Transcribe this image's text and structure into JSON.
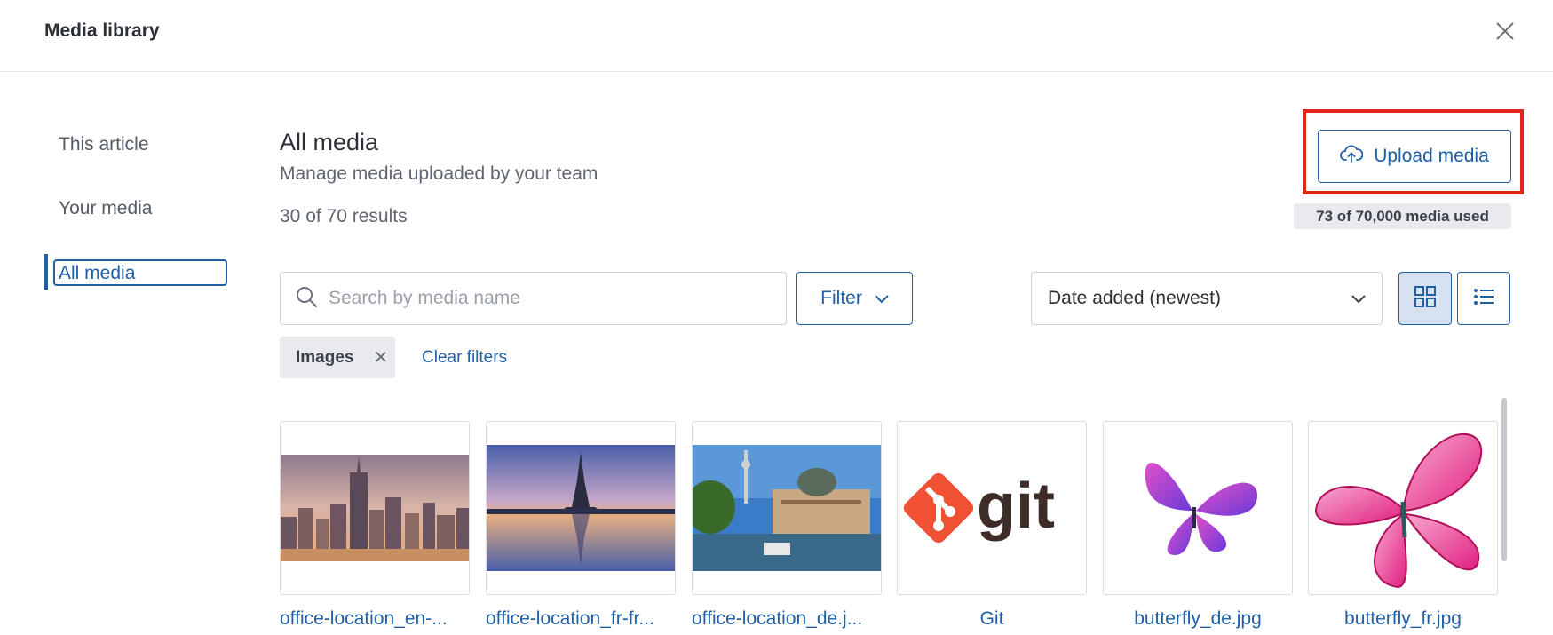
{
  "header": {
    "title": "Media library",
    "close_icon": "close-icon"
  },
  "sidebar": {
    "items": [
      {
        "label": "This article"
      },
      {
        "label": "Your media"
      },
      {
        "label": "All media",
        "active": true
      }
    ]
  },
  "main": {
    "title": "All media",
    "subtitle": "Manage media uploaded by your team",
    "results": "30 of 70 results",
    "upload_label": "Upload media",
    "upload_icon": "cloud-upload-icon",
    "usage": "73 of 70,000 media used",
    "search": {
      "placeholder": "Search by media name",
      "value": ""
    },
    "filter_label": "Filter",
    "sort_value": "Date added (newest)",
    "view_mode": "grid",
    "active_filter": "Images",
    "clear_filters": "Clear filters"
  },
  "media": [
    {
      "name": "office-location_en-...",
      "thumb": "new-york-skyline"
    },
    {
      "name": "office-location_fr-fr...",
      "thumb": "eiffel-tower"
    },
    {
      "name": "office-location_de.j...",
      "thumb": "berlin-museum"
    },
    {
      "name": "Git",
      "thumb": "git-logo"
    },
    {
      "name": "butterfly_de.jpg",
      "thumb": "purple-butterfly"
    },
    {
      "name": "butterfly_fr.jpg",
      "thumb": "pink-butterfly"
    }
  ],
  "colors": {
    "accent": "#1f5fa6",
    "highlight": "#e0261b",
    "git": "#f05133"
  }
}
